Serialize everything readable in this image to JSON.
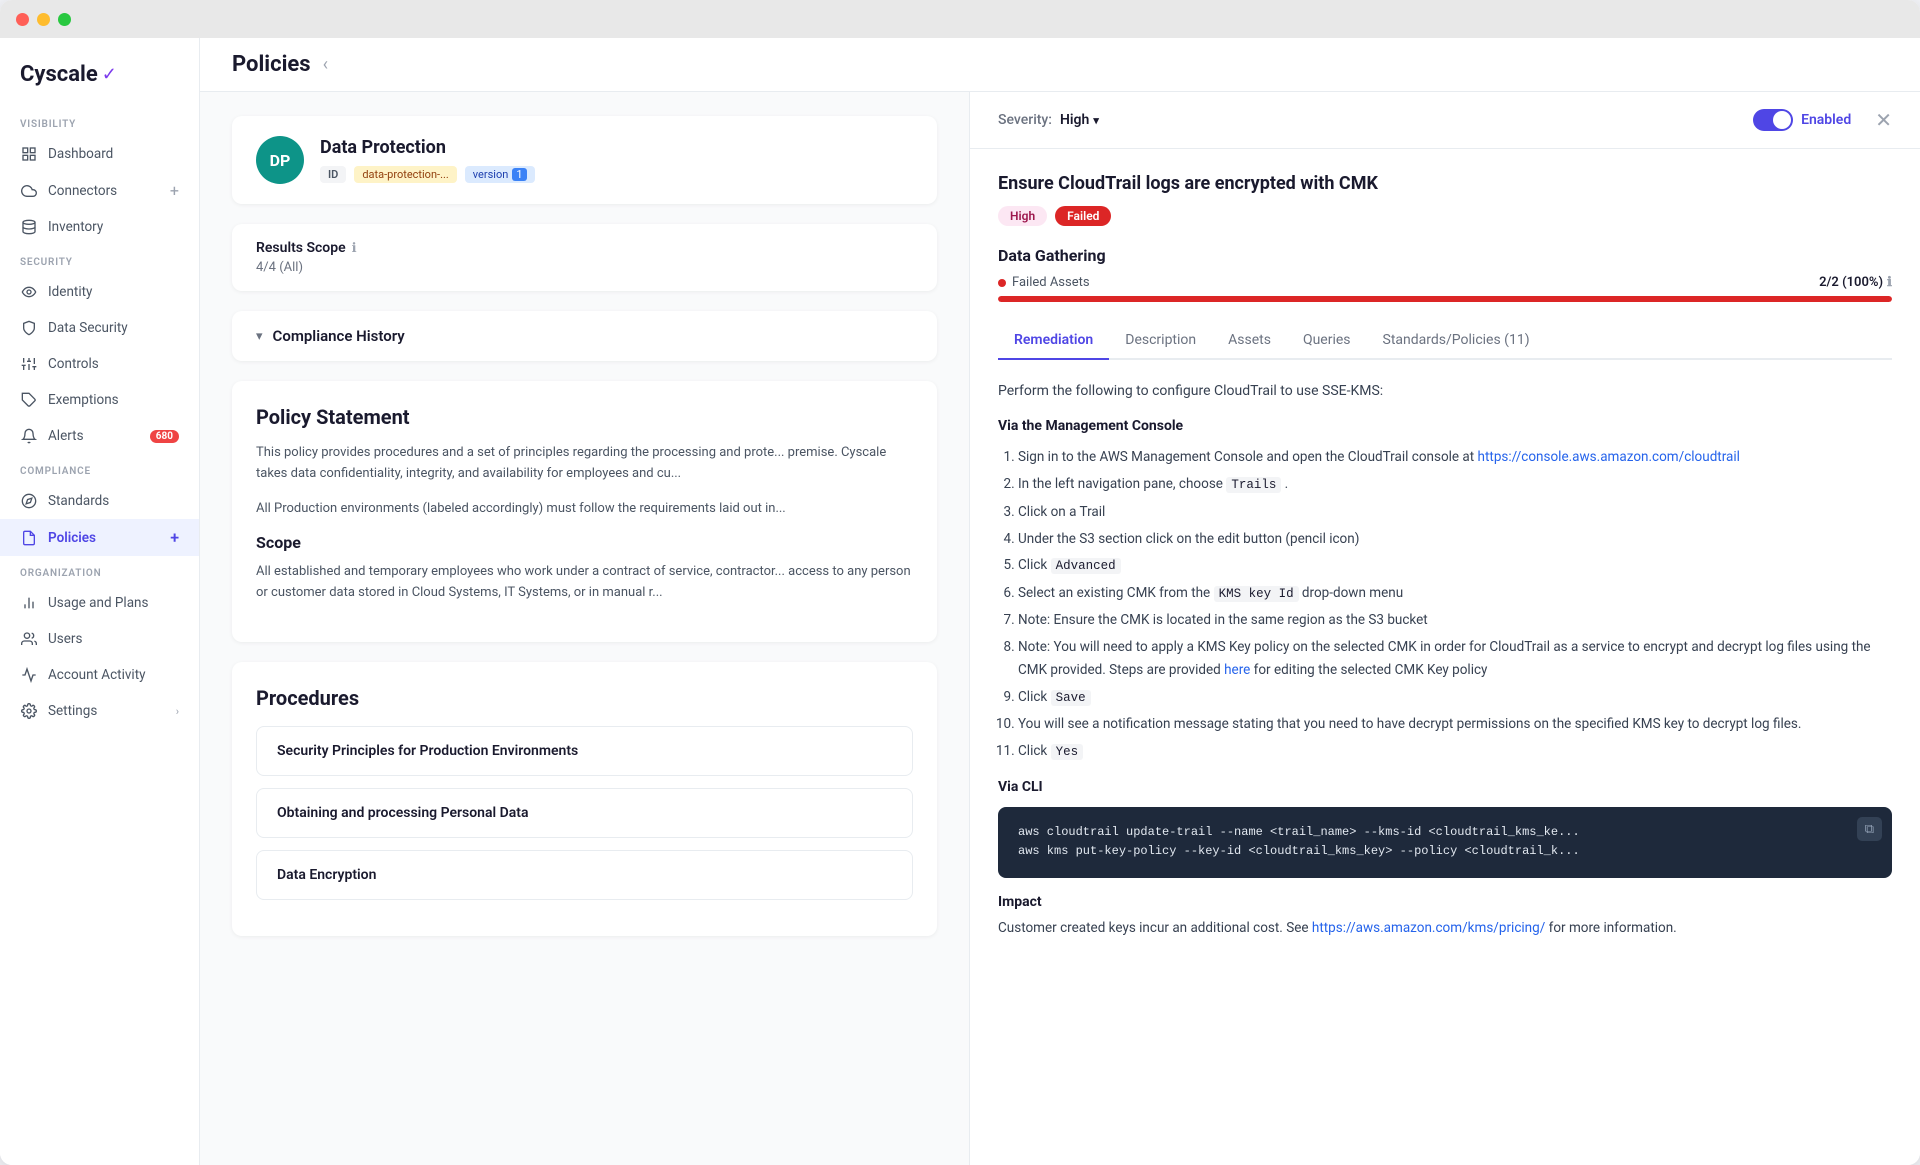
{
  "window": {
    "title": "Cyscale"
  },
  "logo": {
    "text": "Cyscale",
    "check": "✓"
  },
  "sidebar": {
    "visibility_label": "VISIBILITY",
    "security_label": "SECURITY",
    "compliance_label": "COMPLIANCE",
    "organization_label": "ORGANIZATION",
    "items": [
      {
        "id": "dashboard",
        "label": "Dashboard",
        "icon": "grid"
      },
      {
        "id": "connectors",
        "label": "Connectors",
        "icon": "cloud",
        "add": true
      },
      {
        "id": "inventory",
        "label": "Inventory",
        "icon": "database"
      },
      {
        "id": "identity",
        "label": "Identity",
        "icon": "eye"
      },
      {
        "id": "data-security",
        "label": "Data Security",
        "icon": "shield"
      },
      {
        "id": "controls",
        "label": "Controls",
        "icon": "sliders"
      },
      {
        "id": "exemptions",
        "label": "Exemptions",
        "icon": "tag"
      },
      {
        "id": "alerts",
        "label": "Alerts",
        "icon": "bell",
        "badge": "680"
      },
      {
        "id": "standards",
        "label": "Standards",
        "icon": "compass"
      },
      {
        "id": "policies",
        "label": "Policies",
        "icon": "file",
        "active": true,
        "add": true
      },
      {
        "id": "usage-plans",
        "label": "Usage and Plans",
        "icon": "bar-chart"
      },
      {
        "id": "users",
        "label": "Users",
        "icon": "users"
      },
      {
        "id": "account-activity",
        "label": "Account Activity",
        "icon": "activity"
      },
      {
        "id": "settings",
        "label": "Settings",
        "icon": "settings",
        "chevron": true
      }
    ]
  },
  "main": {
    "title": "Policies"
  },
  "dp_card": {
    "avatar": "DP",
    "title": "Data Protection",
    "tag_id": "ID",
    "tag_slug": "data-protection-...",
    "tag_version_label": "version",
    "tag_version_num": "1"
  },
  "results_scope": {
    "label": "Results Scope",
    "value": "4/4 (All)"
  },
  "compliance_history": {
    "title": "Compliance History"
  },
  "policy_statement": {
    "title": "Policy Statement",
    "intro": "This policy provides procedures and a set of principles regarding the processing and prote... premise. Cyscale takes data confidentiality, integrity, and availability for employees and cu...",
    "env_note": "All Production environments (labeled accordingly) must follow the requirements laid out in...",
    "scope_title": "Scope",
    "scope_text": "All established and temporary employees who work under a contract of service, contractor... access to any person or customer data stored in Cloud Systems, IT Systems, or in manual r..."
  },
  "procedures": {
    "title": "Procedures",
    "items": [
      {
        "title": "Security Principles for Production Environments"
      },
      {
        "title": "Obtaining and processing Personal Data"
      },
      {
        "title": "Data Encryption"
      }
    ]
  },
  "right_panel": {
    "severity_label": "Severity:",
    "severity_value": "High",
    "toggle_label": "Enabled",
    "title": "Ensure CloudTrail logs are encrypted with CMK",
    "badge_high": "High",
    "badge_failed": "Failed",
    "data_gathering": {
      "title": "Data Gathering",
      "failed_assets_label": "Failed Assets",
      "failed_assets_value": "2/2 (100%)",
      "bar_percent": 100
    },
    "tabs": [
      {
        "id": "remediation",
        "label": "Remediation",
        "active": true
      },
      {
        "id": "description",
        "label": "Description"
      },
      {
        "id": "assets",
        "label": "Assets"
      },
      {
        "id": "queries",
        "label": "Queries"
      },
      {
        "id": "standards",
        "label": "Standards/Policies (11)"
      }
    ],
    "remediation": {
      "intro": "Perform the following to configure CloudTrail to use SSE-KMS:",
      "via_console_title": "Via the Management Console",
      "steps_console": [
        "Sign in to the AWS Management Console and open the CloudTrail console at https://console.aws.amazon.com/cloudtrail",
        "In the left navigation pane, choose Trails .",
        "Click on a Trail",
        "Under the S3 section click on the edit button (pencil icon)",
        "Click Advanced",
        "Select an existing CMK from the KMS key Id drop-down menu",
        "Note: Ensure the CMK is located in the same region as the S3 bucket",
        "Note: You will need to apply a KMS Key policy on the selected CMK in order for CloudTrail as a service to encrypt and decrypt log files using the CMK provided. Steps are provided here for editing the selected CMK Key policy",
        "Click Save",
        "You will see a notification message stating that you need to have decrypt permissions on the specified KMS key to decrypt log files.",
        "Click Yes"
      ],
      "console_link": "https://console.aws.amazon.com/cloudtrail",
      "via_cli_title": "Via CLI",
      "code_line1": "aws cloudtrail update-trail --name <trail_name> --kms-id <cloudtrail_kms_ke...",
      "code_line2": "aws kms put-key-policy --key-id <cloudtrail_kms_key> --policy <cloudtrail_k...",
      "impact_title": "Impact",
      "impact_text": "Customer created keys incur an additional cost. See https://aws.amazon.com/kms/pricing/ for more information.",
      "impact_link": "https://aws.amazon.com/kms/pricing/",
      "step8_here": "here"
    }
  }
}
